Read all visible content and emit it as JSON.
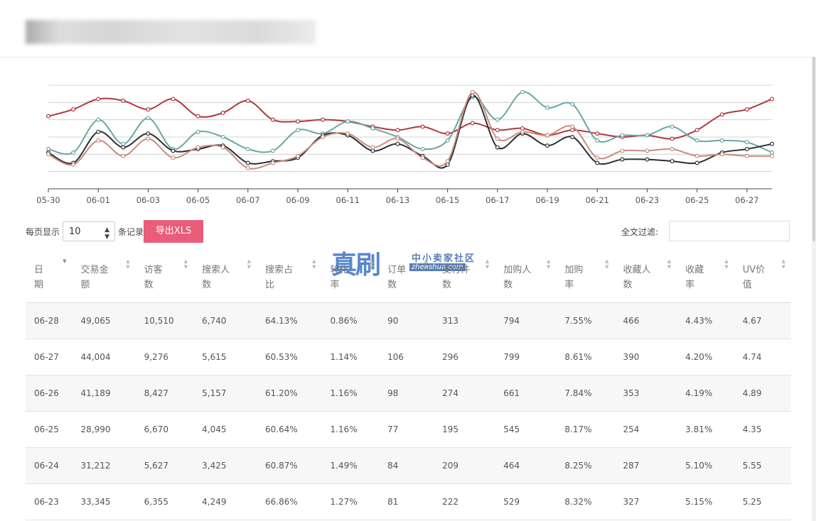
{
  "colors": {
    "red": "#b0393f",
    "teal": "#6aa6a4",
    "black": "#2b2f33",
    "salmon": "#c98b7b",
    "export_btn": "#e95d7a"
  },
  "chart_data": {
    "type": "line",
    "x": [
      "05-30",
      "05-31",
      "06-01",
      "06-02",
      "06-03",
      "06-04",
      "06-05",
      "06-06",
      "06-07",
      "06-08",
      "06-09",
      "06-10",
      "06-11",
      "06-12",
      "06-13",
      "06-14",
      "06-15",
      "06-16",
      "06-17",
      "06-18",
      "06-19",
      "06-20",
      "06-21",
      "06-22",
      "06-23",
      "06-24",
      "06-25",
      "06-26",
      "06-27",
      "06-28"
    ],
    "tick_labels": [
      "05-30",
      "06-01",
      "06-03",
      "06-05",
      "06-07",
      "06-09",
      "06-11",
      "06-13",
      "06-15",
      "06-17",
      "06-19",
      "06-21",
      "06-23",
      "06-25",
      "06-27"
    ],
    "ylim": [
      0,
      6
    ],
    "grid": true,
    "series": [
      {
        "color": "red",
        "values": [
          4.2,
          4.6,
          5.2,
          5.1,
          4.6,
          5.2,
          4.2,
          4.4,
          5.1,
          4.0,
          3.9,
          4.0,
          3.9,
          3.6,
          3.4,
          3.6,
          3.2,
          3.8,
          3.4,
          3.5,
          3.1,
          3.4,
          3.2,
          3.0,
          3.1,
          2.9,
          3.4,
          4.3,
          4.6,
          5.2
        ]
      },
      {
        "color": "teal",
        "values": [
          2.3,
          2.1,
          4.0,
          2.6,
          4.1,
          2.3,
          3.3,
          3.0,
          2.3,
          2.2,
          3.4,
          3.2,
          3.9,
          3.5,
          3.0,
          2.3,
          2.8,
          5.3,
          4.0,
          5.6,
          4.7,
          4.9,
          2.8,
          3.1,
          3.1,
          3.6,
          2.8,
          2.8,
          2.7,
          2.1
        ]
      },
      {
        "color": "black",
        "values": [
          2.1,
          1.5,
          3.3,
          2.4,
          3.2,
          2.2,
          2.3,
          2.5,
          1.5,
          1.6,
          1.8,
          3.1,
          3.1,
          2.2,
          2.6,
          1.9,
          1.4,
          5.4,
          2.4,
          3.2,
          2.5,
          3.0,
          1.5,
          1.7,
          1.7,
          1.6,
          1.5,
          2.1,
          2.3,
          2.6
        ]
      },
      {
        "color": "salmon",
        "values": [
          2.0,
          1.4,
          2.8,
          1.9,
          2.9,
          1.8,
          2.4,
          2.4,
          1.2,
          1.5,
          1.9,
          3.0,
          3.2,
          2.4,
          2.9,
          1.8,
          1.6,
          5.6,
          2.9,
          3.3,
          3.1,
          3.6,
          1.8,
          2.2,
          2.2,
          2.3,
          1.9,
          2.0,
          1.9,
          1.9
        ]
      }
    ]
  },
  "controls": {
    "per_page_label": "每页显示",
    "per_page_value": "10",
    "records_label": "条记录",
    "export_label": "导出XLS",
    "filter_label": "全文过滤:"
  },
  "watermark": {
    "big": "真刷",
    "small": "中小卖家社区",
    "sub": "zhenshua.com"
  },
  "table": {
    "headers": [
      {
        "l1": "日",
        "l2": "期"
      },
      {
        "l1": "交易金",
        "l2": "额"
      },
      {
        "l1": "访客",
        "l2": "数"
      },
      {
        "l1": "搜索人",
        "l2": "数"
      },
      {
        "l1": "搜索占",
        "l2": "比"
      },
      {
        "l1": "转化",
        "l2": "率"
      },
      {
        "l1": "订单",
        "l2": "数"
      },
      {
        "l1": "支付件",
        "l2": "数"
      },
      {
        "l1": "加购人",
        "l2": "数"
      },
      {
        "l1": "加购",
        "l2": "率"
      },
      {
        "l1": "收藏人",
        "l2": "数"
      },
      {
        "l1": "收藏",
        "l2": "率"
      },
      {
        "l1": "UV价",
        "l2": "值"
      }
    ],
    "rows": [
      [
        "06-28",
        "49,065",
        "10,510",
        "6,740",
        "64.13%",
        "0.86%",
        "90",
        "313",
        "794",
        "7.55%",
        "466",
        "4.43%",
        "4.67"
      ],
      [
        "06-27",
        "44,004",
        "9,276",
        "5,615",
        "60.53%",
        "1.14%",
        "106",
        "296",
        "799",
        "8.61%",
        "390",
        "4.20%",
        "4.74"
      ],
      [
        "06-26",
        "41,189",
        "8,427",
        "5,157",
        "61.20%",
        "1.16%",
        "98",
        "274",
        "661",
        "7.84%",
        "353",
        "4.19%",
        "4.89"
      ],
      [
        "06-25",
        "28,990",
        "6,670",
        "4,045",
        "60.64%",
        "1.16%",
        "77",
        "195",
        "545",
        "8.17%",
        "254",
        "3.81%",
        "4.35"
      ],
      [
        "06-24",
        "31,212",
        "5,627",
        "3,425",
        "60.87%",
        "1.49%",
        "84",
        "209",
        "464",
        "8.25%",
        "287",
        "5.10%",
        "5.55"
      ],
      [
        "06-23",
        "33,345",
        "6,355",
        "4,249",
        "66.86%",
        "1.27%",
        "81",
        "222",
        "529",
        "8.32%",
        "327",
        "5.15%",
        "5.25"
      ]
    ]
  }
}
